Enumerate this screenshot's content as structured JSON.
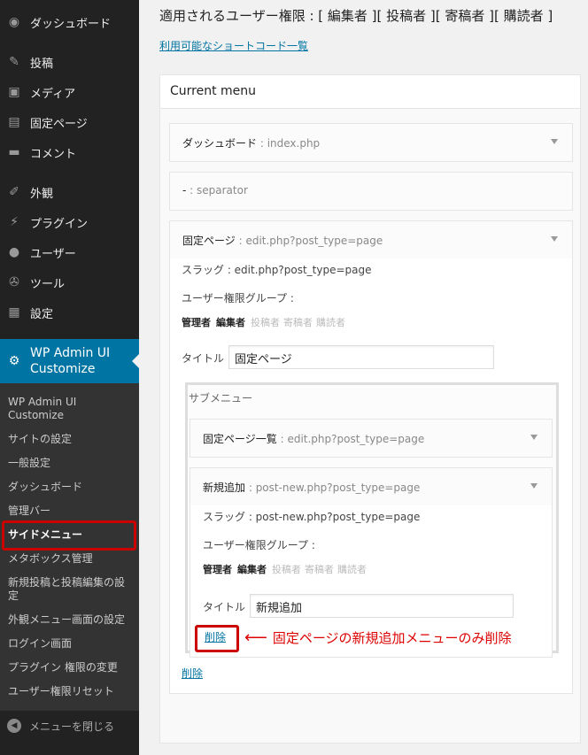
{
  "sidebar": {
    "items": [
      {
        "label": "ダッシュボード",
        "icon": "dashboard-icon"
      },
      {
        "label": "投稿",
        "icon": "pin-icon"
      },
      {
        "label": "メディア",
        "icon": "media-icon"
      },
      {
        "label": "固定ページ",
        "icon": "page-icon"
      },
      {
        "label": "コメント",
        "icon": "comment-icon"
      },
      {
        "label": "外観",
        "icon": "appearance-icon"
      },
      {
        "label": "プラグイン",
        "icon": "plugin-icon"
      },
      {
        "label": "ユーザー",
        "icon": "user-icon"
      },
      {
        "label": "ツール",
        "icon": "wrench-icon"
      },
      {
        "label": "設定",
        "icon": "settings-icon"
      }
    ],
    "active": {
      "label_line1": "WP Admin UI",
      "label_line2": "Customize",
      "icon": "gear-icon"
    },
    "submenu": [
      {
        "label": "WP Admin UI Customize"
      },
      {
        "label": "サイトの設定"
      },
      {
        "label": "一般設定"
      },
      {
        "label": "ダッシュボード"
      },
      {
        "label": "管理バー"
      },
      {
        "label": "サイドメニュー"
      },
      {
        "label": "メタボックス管理"
      },
      {
        "label": "新規投稿と投稿編集の設定"
      },
      {
        "label": "外観メニュー画面の設定"
      },
      {
        "label": "ログイン画面"
      },
      {
        "label": "プラグイン 権限の変更"
      },
      {
        "label": "ユーザー権限リセット"
      }
    ],
    "collapse_label": "メニューを閉じる"
  },
  "main": {
    "heading": "適用されるユーザー権限 : [ 編集者 ][ 投稿者 ][ 寄稿者 ][ 購読者 ]",
    "shortcode_link": "利用可能なショートコード一覧",
    "box_title": "Current menu",
    "rows": [
      {
        "name": "ダッシュボード",
        "sep": " : ",
        "value": "index.php"
      },
      {
        "name": "-",
        "sep": " : ",
        "value": "separator"
      },
      {
        "name": "固定ページ",
        "sep": " : ",
        "value": "edit.php?post_type=page"
      }
    ],
    "page_body": {
      "slug": "スラッグ : edit.php?post_type=page",
      "group_label": "ユーザー権限グループ :",
      "roles_on": [
        "管理者",
        "編集者"
      ],
      "roles_off": [
        "投稿者",
        "寄稿者",
        "購読者"
      ],
      "title_label": "タイトル :",
      "title_value": "固定ページ",
      "submenu_title": "サブメニュー",
      "sub_rows": [
        {
          "name": "固定ページ一覧",
          "sep": " : ",
          "value": "edit.php?post_type=page"
        },
        {
          "name": "新規追加",
          "sep": " : ",
          "value": "post-new.php?post_type=page"
        }
      ],
      "sub_body": {
        "slug": "スラッグ : post-new.php?post_type=page",
        "group_label": "ユーザー権限グループ :",
        "roles_on": [
          "管理者",
          "編集者"
        ],
        "roles_off": [
          "投稿者",
          "寄稿者",
          "購読者"
        ],
        "title_label": "タイトル :",
        "title_value": "新規追加",
        "delete_label": "削除"
      },
      "delete_label": "削除"
    },
    "annotation": "固定ページの新規追加メニューのみ削除"
  },
  "colors": {
    "sidebar_bg": "#222222",
    "active_bg": "#0074a2",
    "link": "#0074a2",
    "highlight": "#cc0000"
  }
}
